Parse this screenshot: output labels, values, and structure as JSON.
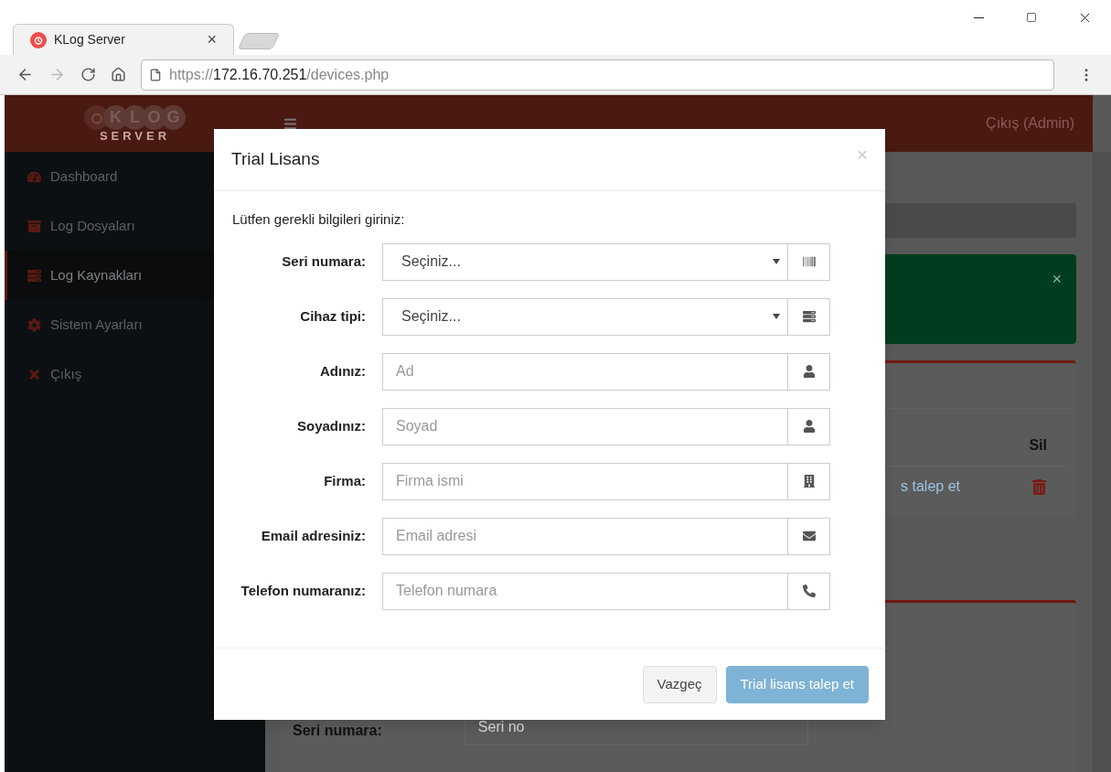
{
  "browser": {
    "tab_title": "KLog Server",
    "tab_close": "×",
    "url": {
      "scheme": "https://",
      "host": "172.16.70.251",
      "path": "/devices.php"
    }
  },
  "sidebar": {
    "logo": {
      "letters": [
        "K",
        "L",
        "O",
        "G"
      ],
      "subtitle": "SERVER"
    },
    "items": [
      {
        "label": "Dashboard",
        "selected": false
      },
      {
        "label": "Log Dosyaları",
        "selected": false
      },
      {
        "label": "Log Kaynakları",
        "selected": true
      },
      {
        "label": "Sistem Ayarları",
        "selected": false
      },
      {
        "label": "Çıkış",
        "selected": false
      }
    ]
  },
  "header": {
    "user_link": "Çıkış (Admin)"
  },
  "background": {
    "alert_close": "×",
    "table_heading": "Sil",
    "row_link": "s talep et",
    "form_label": "Seri numara:",
    "form_placeholder": "Seri no"
  },
  "modal": {
    "title": "Trial Lisans",
    "close": "×",
    "intro": "Lütfen gerekli bilgileri giriniz:",
    "fields": [
      {
        "label": "Seri numara:",
        "kind": "select",
        "value": "Seçiniz..."
      },
      {
        "label": "Cihaz tipi:",
        "kind": "select",
        "value": "Seçiniz..."
      },
      {
        "label": "Adınız:",
        "kind": "input",
        "placeholder": "Ad"
      },
      {
        "label": "Soyadınız:",
        "kind": "input",
        "placeholder": "Soyad"
      },
      {
        "label": "Firma:",
        "kind": "input",
        "placeholder": "Firma ismi"
      },
      {
        "label": "Email adresiniz:",
        "kind": "input",
        "placeholder": "Email adresi"
      },
      {
        "label": "Telefon numaranız:",
        "kind": "input",
        "placeholder": "Telefon numara"
      }
    ],
    "buttons": [
      {
        "label": "Vazgeç",
        "kind": "default",
        "disabled": false
      },
      {
        "label": "Trial lisans talep et",
        "kind": "primary",
        "disabled": true
      }
    ]
  }
}
